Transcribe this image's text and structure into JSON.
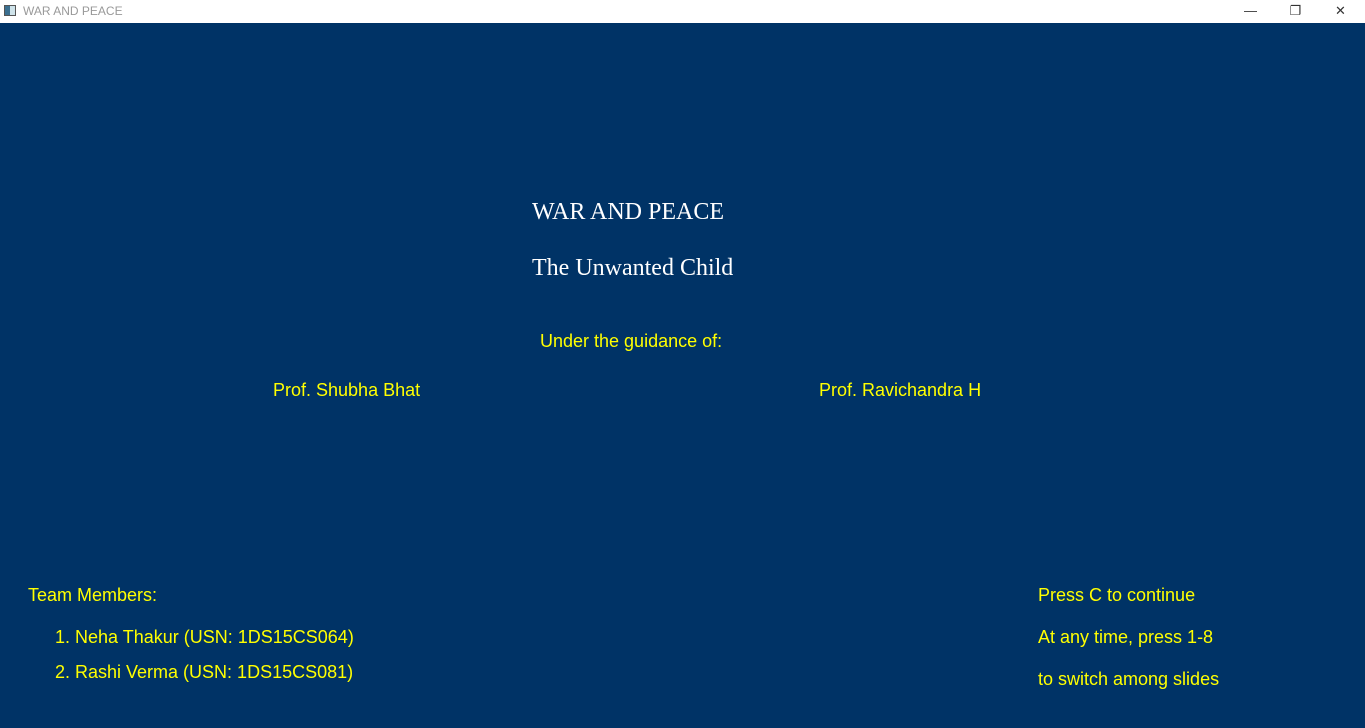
{
  "window": {
    "title": "WAR AND PEACE",
    "controls": {
      "minimize": "—",
      "restore": "❐",
      "close": "✕"
    }
  },
  "slide": {
    "title": "WAR AND PEACE",
    "subtitle": "The Unwanted Child",
    "guidance_label": "Under the guidance of:",
    "guides": [
      "Prof. Shubha Bhat",
      "Prof. Ravichandra H"
    ],
    "team_label": "Team Members:",
    "team": [
      "1. Neha Thakur (USN: 1DS15CS064)",
      "2. Rashi Verma (USN: 1DS15CS081)"
    ],
    "instructions": [
      "Press C to continue",
      "At any time, press 1-8",
      "to switch among slides"
    ]
  },
  "colors": {
    "background": "#003366",
    "text": "#ffff00",
    "title": "#ffffff"
  }
}
